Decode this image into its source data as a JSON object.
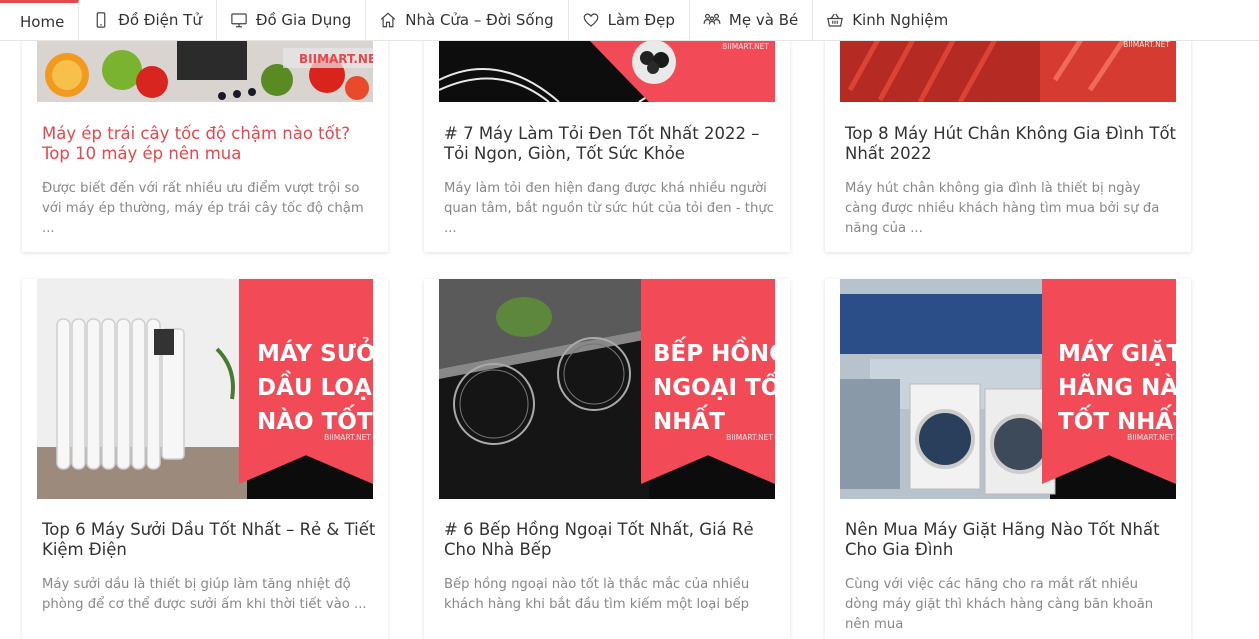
{
  "nav": [
    {
      "label": "Home",
      "icon": "none",
      "active": true
    },
    {
      "label": "Đồ Điện Tử",
      "icon": "phone-icon"
    },
    {
      "label": "Đồ Gia Dụng",
      "icon": "monitor-icon"
    },
    {
      "label": "Nhà Cửa – Đời Sống",
      "icon": "home-icon"
    },
    {
      "label": "Làm Đẹp",
      "icon": "heart-icon"
    },
    {
      "label": "Mẹ và Bé",
      "icon": "family-icon"
    },
    {
      "label": "Kinh Nghiệm",
      "icon": "basket-icon"
    }
  ],
  "watermark": "BIIMART.NET",
  "brand_red": "#f24b57",
  "posts_top": [
    {
      "title": "Máy ép trái cây tốc độ chậm nào tốt? Top 10 máy ép nên mua",
      "excerpt": "Được biết đến với rất nhiều ưu điểm vượt trội so với máy ép thường, máy ép trái cây tốc độ chậm ...",
      "logo": "BIIMART.NET"
    },
    {
      "title": "# 7 Máy Làm Tỏi Đen Tốt Nhất 2022 – Tỏi Ngon, Giòn, Tốt Sức Khỏe",
      "excerpt": "Máy làm tỏi đen hiện đang được khá nhiều người quan tâm, bắt nguồn từ sức hút của tỏi đen - thực ..."
    },
    {
      "title": "Top 8 Máy Hút Chân Không Gia Đình Tốt Nhất 2022",
      "excerpt": "Máy hút chân không gia đình là thiết bị ngày càng được nhiều khách hàng tìm mua bởi sự đa năng của ..."
    }
  ],
  "posts_bottom": [
    {
      "title": "Top 6 Máy Sưởi Dầu Tốt Nhất – Rẻ & Tiết Kiệm Điện",
      "excerpt": "Máy sưởi dầu là thiết bị giúp làm tăng nhiệt độ phòng để cơ thể được sưởi ấm khi thời tiết vào ...",
      "banner": "MÁY SƯỞI\nDẦU LOẠI\nNÀO TỐT?"
    },
    {
      "title": "# 6 Bếp Hồng Ngoại Tốt Nhất, Giá Rẻ Cho Nhà Bếp",
      "excerpt": "Bếp hồng ngoại nào tốt là thắc mắc của nhiều khách hàng khi bắt đầu tìm kiếm một loại bếp",
      "banner": "BẾP HỒNG\nNGOẠI TỐT\nNHẤT"
    },
    {
      "title": "Nên Mua Máy Giặt Hãng Nào Tốt Nhất Cho Gia Đình",
      "excerpt": "Cùng với việc các hãng cho ra mắt rất nhiều dòng máy giặt thì khách hàng càng băn khoăn nên mua",
      "banner": "MÁY GIẶT\nHÃNG NÀO\nTỐT NHẤT?"
    }
  ]
}
